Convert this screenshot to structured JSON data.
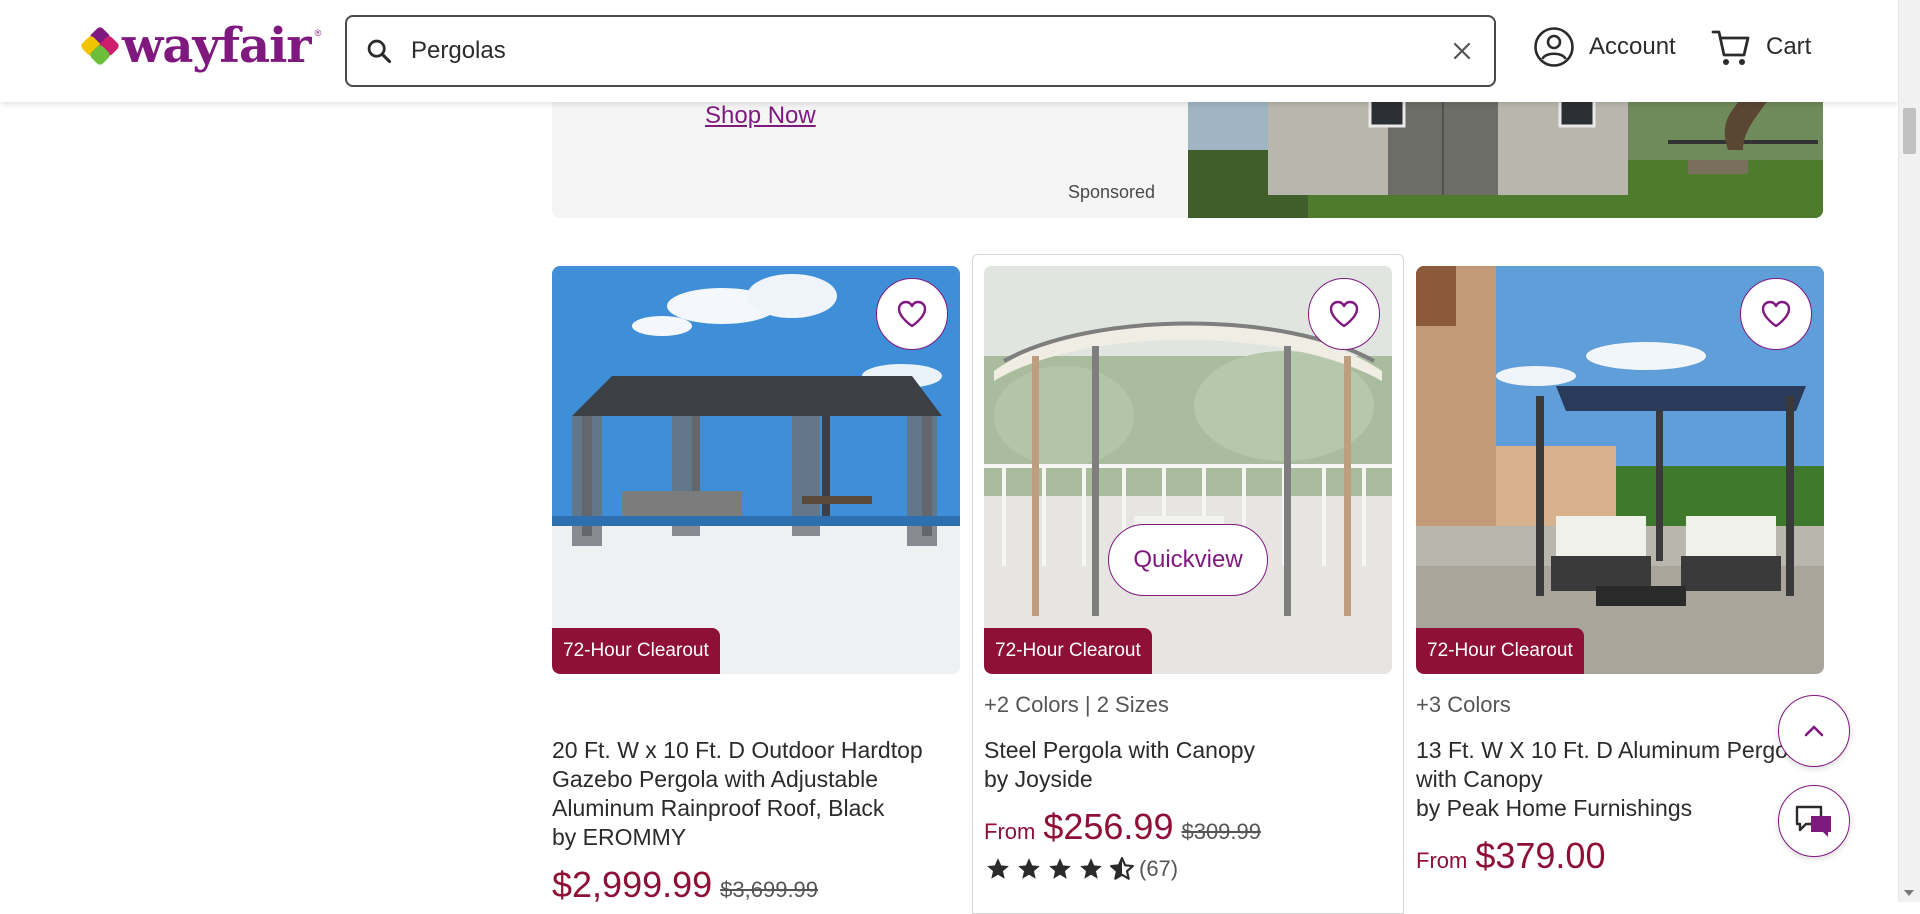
{
  "header": {
    "logo_text": "wayfair",
    "logo_tm": "®",
    "search_value": "Pergolas",
    "account_label": "Account",
    "cart_label": "Cart"
  },
  "banner": {
    "shop_now": "Shop Now",
    "sponsored": "Sponsored"
  },
  "products": [
    {
      "variants": "",
      "title": "20 Ft. W x 10 Ft. D Outdoor Hardtop Gazebo Pergola with Adjustable Aluminum Rainproof Roof, Black",
      "by": "by EROMMY",
      "from": "",
      "price": "$2,999.99",
      "was": "$3,699.99",
      "badge": "72-Hour Clearout"
    },
    {
      "variants": "+2 Colors | 2 Sizes",
      "title": "Steel Pergola with Canopy",
      "by": "by Joyside",
      "from": "From",
      "price": "$256.99",
      "was": "$309.99",
      "badge": "72-Hour Clearout",
      "quickview": "Quickview",
      "rating": 4.5,
      "review_count": "(67)"
    },
    {
      "variants": "+3 Colors",
      "title": "13 Ft. W X 10 Ft. D Aluminum Pergola with Canopy",
      "by": "by Peak Home Furnishings",
      "from": "From",
      "price": "$379.00",
      "was": "",
      "badge": "72-Hour Clearout"
    }
  ],
  "colors": {
    "brand": "#7f187f",
    "sale": "#8f1036"
  }
}
